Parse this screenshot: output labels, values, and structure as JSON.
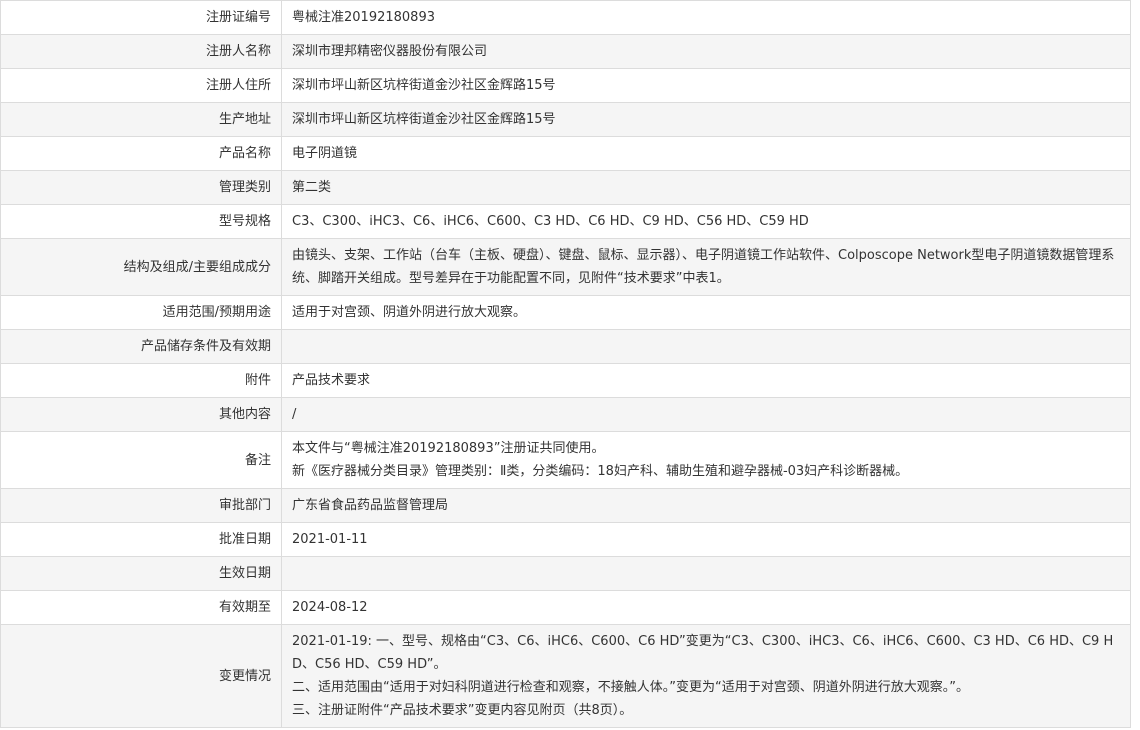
{
  "rows": [
    {
      "label": "注册证编号",
      "value": [
        "粤械注准20192180893"
      ]
    },
    {
      "label": "注册人名称",
      "value": [
        "深圳市理邦精密仪器股份有限公司"
      ]
    },
    {
      "label": "注册人住所",
      "value": [
        "深圳市坪山新区坑梓街道金沙社区金辉路15号"
      ]
    },
    {
      "label": "生产地址",
      "value": [
        "深圳市坪山新区坑梓街道金沙社区金辉路15号"
      ]
    },
    {
      "label": "产品名称",
      "value": [
        "电子阴道镜"
      ]
    },
    {
      "label": "管理类别",
      "value": [
        "第二类"
      ]
    },
    {
      "label": "型号规格",
      "value": [
        "C3、C300、iHC3、C6、iHC6、C600、C3 HD、C6 HD、C9 HD、C56 HD、C59 HD"
      ]
    },
    {
      "label": "结构及组成/主要组成成分",
      "value": [
        "由镜头、支架、工作站（台车（主板、硬盘）、键盘、鼠标、显示器）、电子阴道镜工作站软件、Colposcope Network型电子阴道镜数据管理系统、脚踏开关组成。型号差异在于功能配置不同，见附件“技术要求”中表1。"
      ]
    },
    {
      "label": "适用范围/预期用途",
      "value": [
        "适用于对宫颈、阴道外阴进行放大观察。"
      ]
    },
    {
      "label": "产品储存条件及有效期",
      "value": [
        ""
      ]
    },
    {
      "label": "附件",
      "value": [
        "产品技术要求"
      ]
    },
    {
      "label": "其他内容",
      "value": [
        "/"
      ]
    },
    {
      "label": "备注",
      "value": [
        "本文件与“粤械注准20192180893”注册证共同使用。",
        "新《医疗器械分类目录》管理类别：Ⅱ类，分类编码：18妇产科、辅助生殖和避孕器械-03妇产科诊断器械。"
      ]
    },
    {
      "label": "审批部门",
      "value": [
        "广东省食品药品监督管理局"
      ]
    },
    {
      "label": "批准日期",
      "value": [
        "2021-01-11"
      ]
    },
    {
      "label": "生效日期",
      "value": [
        ""
      ]
    },
    {
      "label": "有效期至",
      "value": [
        "2024-08-12"
      ]
    },
    {
      "label": "变更情况",
      "value": [
        "2021-01-19: 一、型号、规格由“C3、C6、iHC6、C600、C6 HD”变更为“C3、C300、iHC3、C6、iHC6、C600、C3 HD、C6 HD、C9 HD、C56 HD、C59 HD”。",
        "二、适用范围由“适用于对妇科阴道进行检查和观察，不接触人体。”变更为“适用于对宫颈、阴道外阴进行放大观察。”。",
        "三、注册证附件“产品技术要求”变更内容见附页（共8页）。"
      ]
    }
  ]
}
